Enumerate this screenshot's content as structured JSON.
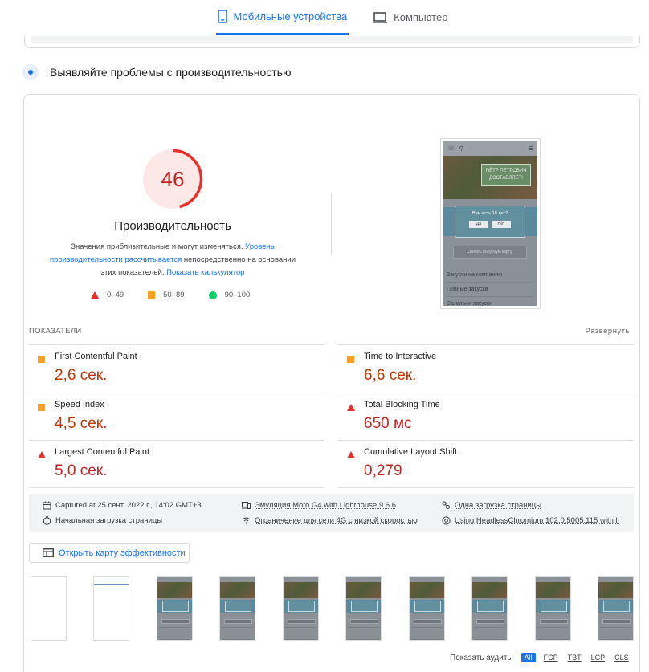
{
  "tabs": [
    {
      "label": "Мобильные устройства",
      "icon": "phone-icon",
      "active": true
    },
    {
      "label": "Компьютер",
      "icon": "desktop-icon",
      "active": false
    }
  ],
  "section": {
    "title": "Выявляйте проблемы с производительностью"
  },
  "score": {
    "value": 46,
    "value_text": "46",
    "color": "#e8302a",
    "label": "Производительность",
    "desc_1": "Значения приблизительные и могут изменяться.",
    "desc_link_1": "Уровень производительности рассчитывается",
    "desc_2": "непосредственно на основании этих показателей.",
    "desc_link_2": "Показать калькулятор"
  },
  "legend": [
    {
      "shape": "triangle",
      "range": "0–49",
      "color": "#e8302a"
    },
    {
      "shape": "square",
      "range": "50–89",
      "color": "#fa9f24"
    },
    {
      "shape": "circle",
      "range": "90–100",
      "color": "#0cce6b"
    }
  ],
  "preview": {
    "banner": "ПЁТР ПЕТРОВИЧ ДОСТАВЛЯЕТ!",
    "modal_question": "Вам есть 18 лет?",
    "modal_yes": "Да",
    "modal_no": "Нет",
    "card_button": "Скачать бонусную карту",
    "menu": [
      "Закуски на компанию",
      "Пивные закуски",
      "Салаты и закуски"
    ]
  },
  "metrics": {
    "heading": "ПОКАЗАТЕЛИ",
    "expand": "Развернуть",
    "items": [
      {
        "name": "First Contentful Paint",
        "value": "2,6 сек.",
        "rating": "average"
      },
      {
        "name": "Time to Interactive",
        "value": "6,6 сек.",
        "rating": "average"
      },
      {
        "name": "Speed Index",
        "value": "4,5 сек.",
        "rating": "average"
      },
      {
        "name": "Total Blocking Time",
        "value": "650 мс",
        "rating": "fail"
      },
      {
        "name": "Largest Contentful Paint",
        "value": "5,0 сек.",
        "rating": "fail"
      },
      {
        "name": "Cumulative Layout Shift",
        "value": "0,279",
        "rating": "fail"
      }
    ]
  },
  "runtime": {
    "captured": "Captured at 25 сент. 2022 г., 14:02 GMT+3",
    "emulation": "Эмуляция Moto G4 with Lighthouse 9.6.6",
    "page_load": "Одна загрузка страницы",
    "initial_load": "Начальная загрузка страницы",
    "throttling": "Ограничение для сети 4G с низкой скоростью",
    "browser": "Using HeadlessChromium 102.0.5005.115 with lr"
  },
  "treemap": {
    "label": "Открыть карту эффективности"
  },
  "audits": {
    "label": "Показать аудиты",
    "filters": [
      "All",
      "FCP",
      "TBT",
      "LCP",
      "CLS"
    ]
  }
}
